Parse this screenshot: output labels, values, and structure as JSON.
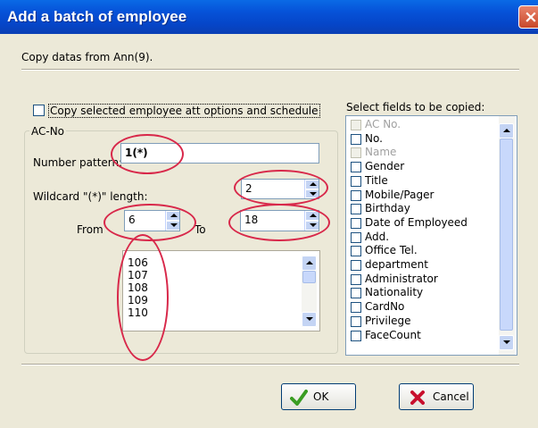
{
  "window": {
    "title": "Add a batch of employee",
    "close_glyph": "×"
  },
  "copy_from_text": "Copy datas from Ann(9).",
  "copy_options_checkbox": {
    "label": "Copy selected employee att options and schedule",
    "checked": false
  },
  "acno_group": {
    "title": "AC-No",
    "number_pattern_label": "Number pattern:",
    "number_pattern_value": "1(*)",
    "wildcard_label": "Wildcard \"(*)\" length:",
    "wildcard_value": "2",
    "from_label": "From",
    "from_value": "6",
    "to_label": "To",
    "to_value": "18",
    "generated_numbers": [
      "106",
      "107",
      "108",
      "109",
      "110"
    ]
  },
  "fields": {
    "label": "Select fields to be copied:",
    "items": [
      {
        "label": "AC No.",
        "checked": false,
        "disabled": true
      },
      {
        "label": "No.",
        "checked": false,
        "disabled": false
      },
      {
        "label": "Name",
        "checked": false,
        "disabled": true
      },
      {
        "label": "Gender",
        "checked": false,
        "disabled": false
      },
      {
        "label": "Title",
        "checked": false,
        "disabled": false
      },
      {
        "label": "Mobile/Pager",
        "checked": false,
        "disabled": false
      },
      {
        "label": "Birthday",
        "checked": false,
        "disabled": false
      },
      {
        "label": "Date of Employeed",
        "checked": false,
        "disabled": false
      },
      {
        "label": "Add.",
        "checked": false,
        "disabled": false
      },
      {
        "label": "Office Tel.",
        "checked": false,
        "disabled": false
      },
      {
        "label": "department",
        "checked": false,
        "disabled": false
      },
      {
        "label": "Administrator",
        "checked": false,
        "disabled": false
      },
      {
        "label": "Nationality",
        "checked": false,
        "disabled": false
      },
      {
        "label": "CardNo",
        "checked": false,
        "disabled": false
      },
      {
        "label": "Privilege",
        "checked": false,
        "disabled": false
      },
      {
        "label": "FaceCount",
        "checked": false,
        "disabled": false
      }
    ]
  },
  "buttons": {
    "ok_label": "OK",
    "cancel_label": "Cancel"
  },
  "colors": {
    "title_bar": "#0554d8",
    "annotation_ring": "#d8284a",
    "ok_check": "#3a9d23",
    "cancel_x": "#c8102e"
  },
  "icons": {
    "ok": "checkmark-icon",
    "cancel": "x-mark-icon",
    "close": "close-icon"
  }
}
